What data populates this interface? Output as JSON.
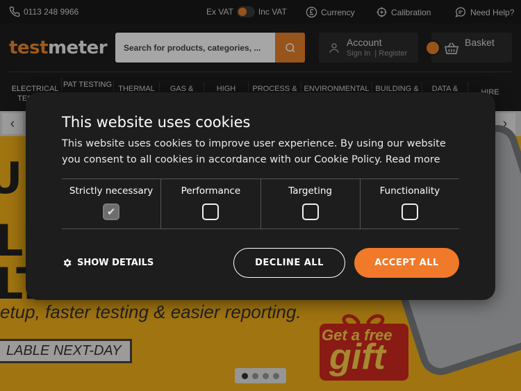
{
  "topbar": {
    "phone": "0113 248 9966",
    "ex_vat": "Ex VAT",
    "inc_vat": "Inc VAT",
    "currency": "Currency",
    "calibration": "Calibration",
    "need_help": "Need Help?"
  },
  "header": {
    "logo_part1": "test",
    "logo_part2": "meter",
    "search_placeholder": "Search for products, categories, ...",
    "account_label": "Account",
    "sign_in": "Sign In",
    "register": "Register",
    "basket_label": "Basket"
  },
  "nav": {
    "items": [
      {
        "label": "ELECTRICAL TESTERS"
      },
      {
        "label": "PAT TESTING"
      },
      {
        "label": "THERMAL"
      },
      {
        "label": "GAS &"
      },
      {
        "label": "HIGH"
      },
      {
        "label": "PROCESS &"
      },
      {
        "label": "ENVIRONMENTAL"
      },
      {
        "label": "BUILDING &"
      },
      {
        "label": "DATA &"
      },
      {
        "label": "HIRE"
      }
    ]
  },
  "hero": {
    "tagline": "etup, faster testing & easier reporting.",
    "available": "LABLE NEXT-DAY",
    "gift_line1": "Get a free",
    "gift_line2": "gift",
    "big_1": "U",
    "big_2": "LU",
    "big_3": "LT"
  },
  "cookie": {
    "title": "This website uses cookies",
    "body": "This website uses cookies to improve user experience. By using our website you consent to all cookies in accordance with our Cookie Policy.",
    "read_more": "Read more",
    "categories": [
      {
        "label": "Strictly necessary",
        "checked": true
      },
      {
        "label": "Performance",
        "checked": false
      },
      {
        "label": "Targeting",
        "checked": false
      },
      {
        "label": "Functionality",
        "checked": false
      }
    ],
    "show_details": "SHOW DETAILS",
    "decline": "DECLINE ALL",
    "accept": "ACCEPT ALL"
  },
  "colors": {
    "accent": "#e8822a",
    "accept_button": "#f07a2a",
    "modal_bg": "#1d1d1d",
    "hero_bg": "#f6b21a"
  }
}
